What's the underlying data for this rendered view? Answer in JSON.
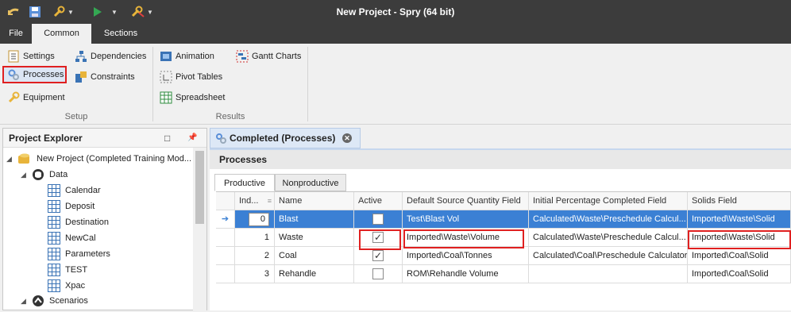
{
  "window": {
    "title": "New Project - Spry (64 bit)"
  },
  "menu_tabs": [
    "File",
    "Common",
    "Sections"
  ],
  "ribbon": {
    "setup": {
      "label": "Setup",
      "buttons": [
        "Settings",
        "Dependencies",
        "Processes",
        "Constraints",
        "Equipment"
      ]
    },
    "results": {
      "label": "Results",
      "buttons": [
        "Animation",
        "Gantt Charts",
        "Pivot Tables",
        "Spreadsheet"
      ]
    }
  },
  "explorer": {
    "title": "Project Explorer",
    "pin_glyph": "📌",
    "float_glyph": "□",
    "root": "New Project (Completed Training Mod...",
    "data_folder": "Data",
    "data_items": [
      "Calendar",
      "Deposit",
      "Destination",
      "NewCal",
      "Parameters",
      "TEST",
      "Xpac"
    ],
    "scenarios": "Scenarios"
  },
  "document": {
    "tab_label": "Completed (Processes)",
    "section_title": "Processes",
    "subtabs": [
      "Productive",
      "Nonproductive"
    ],
    "columns": [
      "Ind...",
      "Name",
      "Active",
      "Default Source Quantity Field",
      "Initial Percentage Completed Field",
      "Solids Field"
    ],
    "rows": [
      {
        "index": "0",
        "name": "Blast",
        "active": false,
        "source": "Test\\Blast Vol",
        "initial": "Calculated\\Waste\\Preschedule Calcul...",
        "solids": "Imported\\Waste\\Solid"
      },
      {
        "index": "1",
        "name": "Waste",
        "active": true,
        "source": "Imported\\Waste\\Volume",
        "initial": "Calculated\\Waste\\Preschedule Calcul...",
        "solids": "Imported\\Waste\\Solid"
      },
      {
        "index": "2",
        "name": "Coal",
        "active": true,
        "source": "Imported\\Coal\\Tonnes",
        "initial": "Calculated\\Coal\\Preschedule Calculator",
        "solids": "Imported\\Coal\\Solid"
      },
      {
        "index": "3",
        "name": "Rehandle",
        "active": false,
        "source": "ROM\\Rehandle Volume",
        "initial": "",
        "solids": "Imported\\Coal\\Solid"
      }
    ],
    "selected_row": 0
  },
  "colors": {
    "accent": "#3b80d4",
    "highlight": "#e02020",
    "chrome": "#3c3c3c"
  }
}
